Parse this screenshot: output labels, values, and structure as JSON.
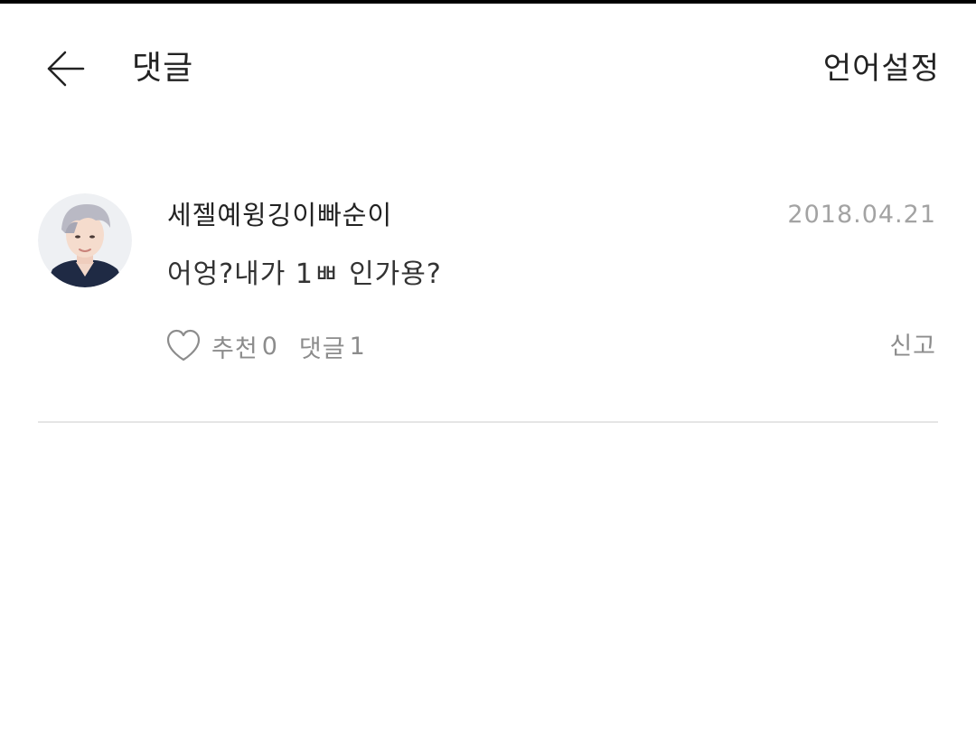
{
  "header": {
    "title": "댓글",
    "language_settings_label": "언어설정",
    "back_icon": "arrow-left-icon"
  },
  "comment": {
    "username": "세젤예윙깅이빠순이",
    "date": "2018.04.21",
    "text": "어엉?내가 1ㅃ 인가용?",
    "like_label": "추천",
    "like_count": "0",
    "reply_label": "댓글",
    "reply_count": "1",
    "report_label": "신고",
    "heart_icon": "heart-outline-icon"
  },
  "colors": {
    "text_primary": "#222222",
    "text_secondary": "#8c8c8c",
    "date": "#a3a3a3",
    "divider": "#e5e5e5"
  }
}
